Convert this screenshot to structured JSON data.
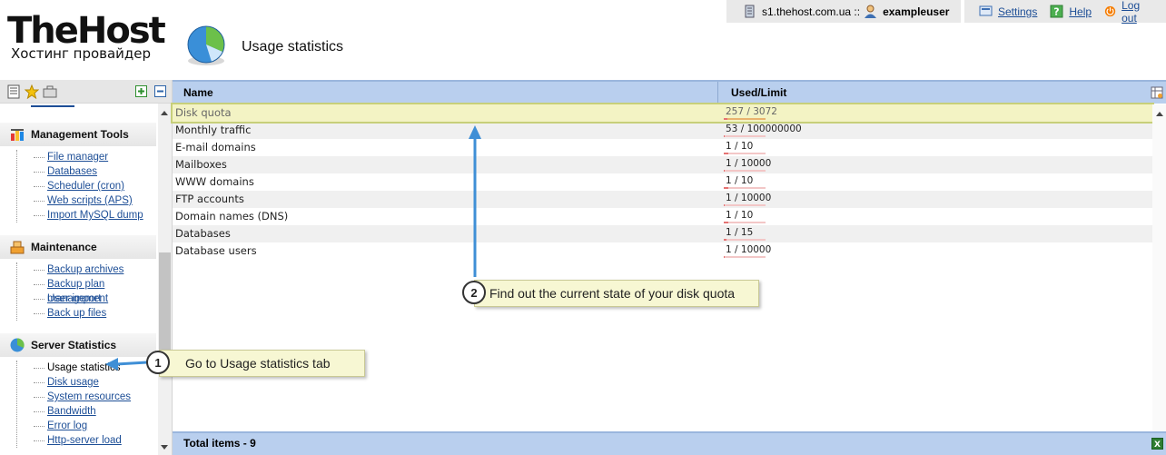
{
  "header": {
    "logo_main": "TheHost",
    "logo_sub": "Хостинг провайдер",
    "page_title": "Usage statistics",
    "server": "s1.thehost.com.ua ::",
    "username": "exampleuser",
    "settings_label": "Settings",
    "help_label": "Help",
    "logout_label": "Log out"
  },
  "sidebar": {
    "groups": [
      {
        "title": "Management Tools",
        "items": [
          "File manager",
          "Databases",
          "Scheduler (cron)",
          "Web scripts (APS)",
          "Import MySQL dump"
        ]
      },
      {
        "title": "Maintenance",
        "items": [
          "Backup archives",
          "Backup plan management",
          "User import",
          "Back up files"
        ]
      },
      {
        "title": "Server Statistics",
        "items": [
          "Usage statistics",
          "Disk usage",
          "System resources",
          "Bandwidth",
          "Error log",
          "Http-server load"
        ]
      }
    ]
  },
  "table": {
    "col_name": "Name",
    "col_used": "Used/Limit",
    "rows": [
      {
        "name": "Disk quota",
        "used": "257 / 3072",
        "fraction": 0.084
      },
      {
        "name": "Monthly traffic",
        "used": "53 / 100000000",
        "fraction": 0.0
      },
      {
        "name": "E-mail domains",
        "used": "1 / 10",
        "fraction": 0.1
      },
      {
        "name": "Mailboxes",
        "used": "1 / 10000",
        "fraction": 0.0
      },
      {
        "name": "WWW domains",
        "used": "1 / 10",
        "fraction": 0.1
      },
      {
        "name": "FTP accounts",
        "used": "1 / 10000",
        "fraction": 0.0
      },
      {
        "name": "Domain names (DNS)",
        "used": "1 / 10",
        "fraction": 0.1
      },
      {
        "name": "Databases",
        "used": "1 / 15",
        "fraction": 0.067
      },
      {
        "name": "Database users",
        "used": "1 / 10000",
        "fraction": 0.0
      }
    ],
    "footer": "Total items - 9"
  },
  "callouts": [
    {
      "num": "1",
      "text": "Go to Usage statistics tab"
    },
    {
      "num": "2",
      "text": "Find out the current state of your disk quota"
    }
  ],
  "colors": {
    "header_blue": "#b9cfee",
    "link_blue": "#1d4e96",
    "arrow_blue": "#3f8fd6",
    "highlight": "#f3f3c4"
  }
}
